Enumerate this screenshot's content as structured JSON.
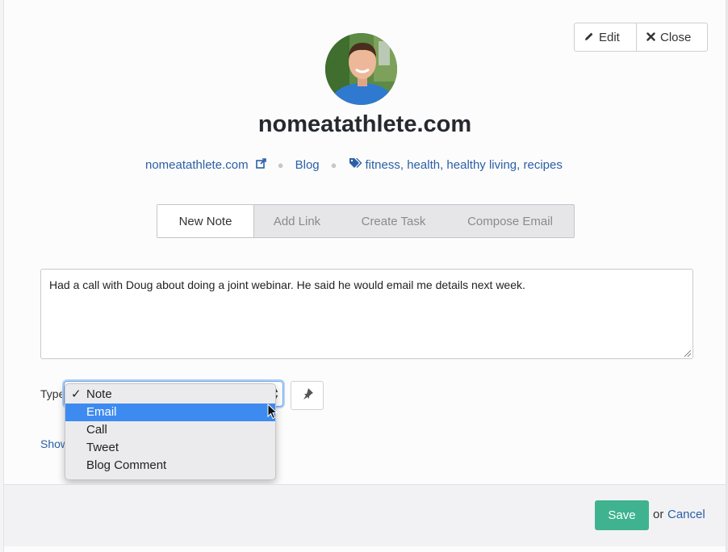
{
  "header": {
    "edit_label": "Edit",
    "close_label": "Close",
    "title": "nomeatathlete.com"
  },
  "meta": {
    "site_link": "nomeatathlete.com",
    "category": "Blog",
    "tags": [
      "fitness",
      "health",
      "healthy living",
      "recipes"
    ]
  },
  "tabs": [
    {
      "label": "New Note",
      "active": true
    },
    {
      "label": "Add Link",
      "active": false
    },
    {
      "label": "Create Task",
      "active": false
    },
    {
      "label": "Compose Email",
      "active": false
    }
  ],
  "note": {
    "text": "Had a call with Doug about doing a joint webinar. He said he would email me details next week."
  },
  "type_field": {
    "label": "Type",
    "selected": "Note",
    "highlighted": "Email",
    "options": [
      "Note",
      "Email",
      "Call",
      "Tweet",
      "Blog Comment"
    ]
  },
  "show_link_partial": "Show",
  "footer": {
    "save_label": "Save",
    "or_text": "or",
    "cancel_label": "Cancel"
  },
  "colors": {
    "link": "#2b5fa6",
    "save": "#3fb38f",
    "highlight": "#3d8bf0"
  }
}
